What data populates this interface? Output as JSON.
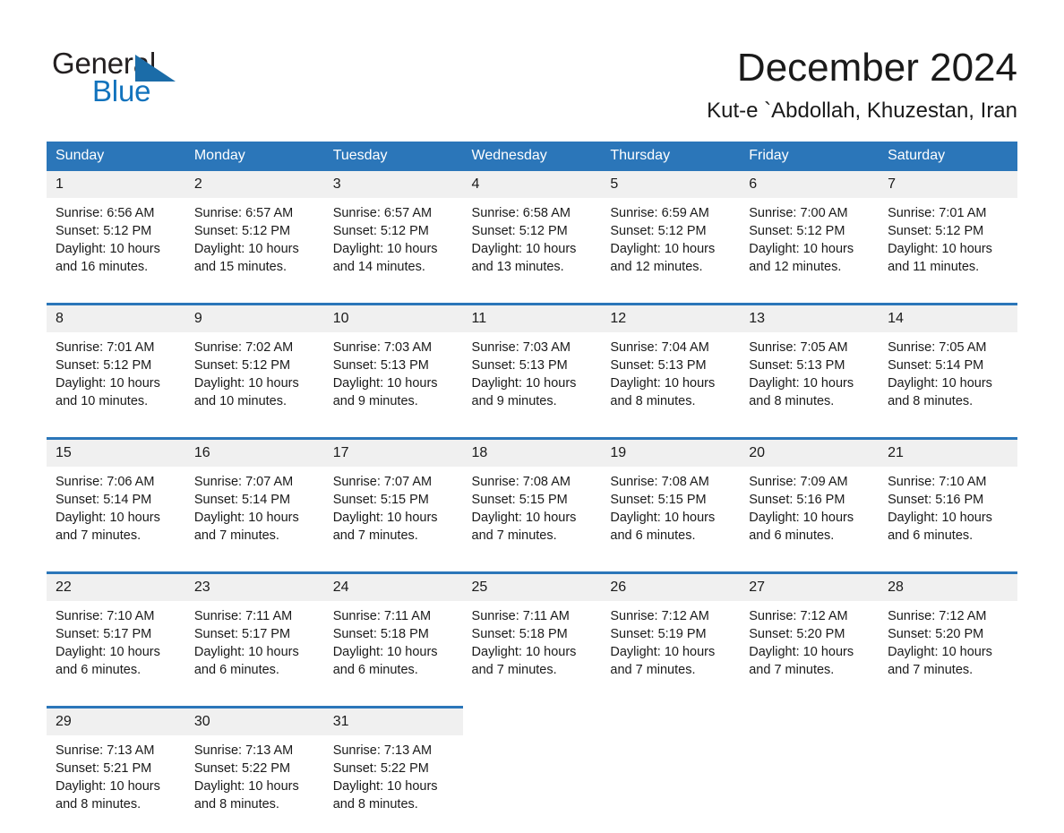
{
  "brand": {
    "word1": "General",
    "word2": "Blue",
    "triangle_color": "#1b6ca8",
    "blue_color": "#1273bd"
  },
  "header": {
    "month_title": "December 2024",
    "location": "Kut-e `Abdollah, Khuzestan, Iran"
  },
  "theme": {
    "header_blue": "#2b76b9",
    "daynum_gray": "#f0f0f0",
    "cell_white": "#ffffff"
  },
  "weekdays": [
    "Sunday",
    "Monday",
    "Tuesday",
    "Wednesday",
    "Thursday",
    "Friday",
    "Saturday"
  ],
  "weeks": [
    {
      "days": [
        {
          "num": "1",
          "sunrise": "Sunrise: 6:56 AM",
          "sunset": "Sunset: 5:12 PM",
          "daylight1": "Daylight: 10 hours",
          "daylight2": "and 16 minutes."
        },
        {
          "num": "2",
          "sunrise": "Sunrise: 6:57 AM",
          "sunset": "Sunset: 5:12 PM",
          "daylight1": "Daylight: 10 hours",
          "daylight2": "and 15 minutes."
        },
        {
          "num": "3",
          "sunrise": "Sunrise: 6:57 AM",
          "sunset": "Sunset: 5:12 PM",
          "daylight1": "Daylight: 10 hours",
          "daylight2": "and 14 minutes."
        },
        {
          "num": "4",
          "sunrise": "Sunrise: 6:58 AM",
          "sunset": "Sunset: 5:12 PM",
          "daylight1": "Daylight: 10 hours",
          "daylight2": "and 13 minutes."
        },
        {
          "num": "5",
          "sunrise": "Sunrise: 6:59 AM",
          "sunset": "Sunset: 5:12 PM",
          "daylight1": "Daylight: 10 hours",
          "daylight2": "and 12 minutes."
        },
        {
          "num": "6",
          "sunrise": "Sunrise: 7:00 AM",
          "sunset": "Sunset: 5:12 PM",
          "daylight1": "Daylight: 10 hours",
          "daylight2": "and 12 minutes."
        },
        {
          "num": "7",
          "sunrise": "Sunrise: 7:01 AM",
          "sunset": "Sunset: 5:12 PM",
          "daylight1": "Daylight: 10 hours",
          "daylight2": "and 11 minutes."
        }
      ]
    },
    {
      "days": [
        {
          "num": "8",
          "sunrise": "Sunrise: 7:01 AM",
          "sunset": "Sunset: 5:12 PM",
          "daylight1": "Daylight: 10 hours",
          "daylight2": "and 10 minutes."
        },
        {
          "num": "9",
          "sunrise": "Sunrise: 7:02 AM",
          "sunset": "Sunset: 5:12 PM",
          "daylight1": "Daylight: 10 hours",
          "daylight2": "and 10 minutes."
        },
        {
          "num": "10",
          "sunrise": "Sunrise: 7:03 AM",
          "sunset": "Sunset: 5:13 PM",
          "daylight1": "Daylight: 10 hours",
          "daylight2": "and 9 minutes."
        },
        {
          "num": "11",
          "sunrise": "Sunrise: 7:03 AM",
          "sunset": "Sunset: 5:13 PM",
          "daylight1": "Daylight: 10 hours",
          "daylight2": "and 9 minutes."
        },
        {
          "num": "12",
          "sunrise": "Sunrise: 7:04 AM",
          "sunset": "Sunset: 5:13 PM",
          "daylight1": "Daylight: 10 hours",
          "daylight2": "and 8 minutes."
        },
        {
          "num": "13",
          "sunrise": "Sunrise: 7:05 AM",
          "sunset": "Sunset: 5:13 PM",
          "daylight1": "Daylight: 10 hours",
          "daylight2": "and 8 minutes."
        },
        {
          "num": "14",
          "sunrise": "Sunrise: 7:05 AM",
          "sunset": "Sunset: 5:14 PM",
          "daylight1": "Daylight: 10 hours",
          "daylight2": "and 8 minutes."
        }
      ]
    },
    {
      "days": [
        {
          "num": "15",
          "sunrise": "Sunrise: 7:06 AM",
          "sunset": "Sunset: 5:14 PM",
          "daylight1": "Daylight: 10 hours",
          "daylight2": "and 7 minutes."
        },
        {
          "num": "16",
          "sunrise": "Sunrise: 7:07 AM",
          "sunset": "Sunset: 5:14 PM",
          "daylight1": "Daylight: 10 hours",
          "daylight2": "and 7 minutes."
        },
        {
          "num": "17",
          "sunrise": "Sunrise: 7:07 AM",
          "sunset": "Sunset: 5:15 PM",
          "daylight1": "Daylight: 10 hours",
          "daylight2": "and 7 minutes."
        },
        {
          "num": "18",
          "sunrise": "Sunrise: 7:08 AM",
          "sunset": "Sunset: 5:15 PM",
          "daylight1": "Daylight: 10 hours",
          "daylight2": "and 7 minutes."
        },
        {
          "num": "19",
          "sunrise": "Sunrise: 7:08 AM",
          "sunset": "Sunset: 5:15 PM",
          "daylight1": "Daylight: 10 hours",
          "daylight2": "and 6 minutes."
        },
        {
          "num": "20",
          "sunrise": "Sunrise: 7:09 AM",
          "sunset": "Sunset: 5:16 PM",
          "daylight1": "Daylight: 10 hours",
          "daylight2": "and 6 minutes."
        },
        {
          "num": "21",
          "sunrise": "Sunrise: 7:10 AM",
          "sunset": "Sunset: 5:16 PM",
          "daylight1": "Daylight: 10 hours",
          "daylight2": "and 6 minutes."
        }
      ]
    },
    {
      "days": [
        {
          "num": "22",
          "sunrise": "Sunrise: 7:10 AM",
          "sunset": "Sunset: 5:17 PM",
          "daylight1": "Daylight: 10 hours",
          "daylight2": "and 6 minutes."
        },
        {
          "num": "23",
          "sunrise": "Sunrise: 7:11 AM",
          "sunset": "Sunset: 5:17 PM",
          "daylight1": "Daylight: 10 hours",
          "daylight2": "and 6 minutes."
        },
        {
          "num": "24",
          "sunrise": "Sunrise: 7:11 AM",
          "sunset": "Sunset: 5:18 PM",
          "daylight1": "Daylight: 10 hours",
          "daylight2": "and 6 minutes."
        },
        {
          "num": "25",
          "sunrise": "Sunrise: 7:11 AM",
          "sunset": "Sunset: 5:18 PM",
          "daylight1": "Daylight: 10 hours",
          "daylight2": "and 7 minutes."
        },
        {
          "num": "26",
          "sunrise": "Sunrise: 7:12 AM",
          "sunset": "Sunset: 5:19 PM",
          "daylight1": "Daylight: 10 hours",
          "daylight2": "and 7 minutes."
        },
        {
          "num": "27",
          "sunrise": "Sunrise: 7:12 AM",
          "sunset": "Sunset: 5:20 PM",
          "daylight1": "Daylight: 10 hours",
          "daylight2": "and 7 minutes."
        },
        {
          "num": "28",
          "sunrise": "Sunrise: 7:12 AM",
          "sunset": "Sunset: 5:20 PM",
          "daylight1": "Daylight: 10 hours",
          "daylight2": "and 7 minutes."
        }
      ]
    },
    {
      "days": [
        {
          "num": "29",
          "sunrise": "Sunrise: 7:13 AM",
          "sunset": "Sunset: 5:21 PM",
          "daylight1": "Daylight: 10 hours",
          "daylight2": "and 8 minutes."
        },
        {
          "num": "30",
          "sunrise": "Sunrise: 7:13 AM",
          "sunset": "Sunset: 5:22 PM",
          "daylight1": "Daylight: 10 hours",
          "daylight2": "and 8 minutes."
        },
        {
          "num": "31",
          "sunrise": "Sunrise: 7:13 AM",
          "sunset": "Sunset: 5:22 PM",
          "daylight1": "Daylight: 10 hours",
          "daylight2": "and 8 minutes."
        },
        {
          "num": "",
          "sunrise": "",
          "sunset": "",
          "daylight1": "",
          "daylight2": ""
        },
        {
          "num": "",
          "sunrise": "",
          "sunset": "",
          "daylight1": "",
          "daylight2": ""
        },
        {
          "num": "",
          "sunrise": "",
          "sunset": "",
          "daylight1": "",
          "daylight2": ""
        },
        {
          "num": "",
          "sunrise": "",
          "sunset": "",
          "daylight1": "",
          "daylight2": ""
        }
      ]
    }
  ]
}
